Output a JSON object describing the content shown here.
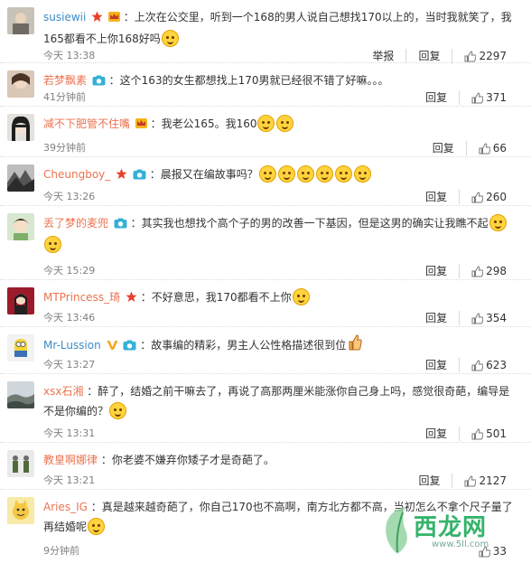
{
  "actions": {
    "report": "举报",
    "reply": "回复"
  },
  "comments": [
    {
      "user": "susiewii",
      "text": "：上次在公交里，听到一个168的男人说自己想找170以上的，当时我就笑了，我165都看不上你168好吗",
      "time": "今天 13:38",
      "likes": "2297",
      "has_report": true
    },
    {
      "user": "若梦飘素",
      "text": "：这个163的女生都想找上170男就已经很不错了好嘛。。。",
      "time": "41分钟前",
      "likes": "371"
    },
    {
      "user": "减不下肥管不住嘴",
      "text": "：我老公165。我160",
      "time": "39分钟前",
      "likes": "66"
    },
    {
      "user": "Cheungboy_",
      "text": "：晨报又在编故事吗？",
      "time": "今天 13:26",
      "likes": "260"
    },
    {
      "user": "丢了梦的麦兜",
      "text": "：其实我也想找个高个子的男的改善一下基因，但是这男的确实让我瞧不起",
      "time": "今天 15:29",
      "likes": "298"
    },
    {
      "user": "MTPrincess_琦",
      "text": "：不好意思，我170都看不上你",
      "time": "今天 13:46",
      "likes": "354"
    },
    {
      "user": "Mr-Lussion",
      "text": "：故事编的精彩，男主人公性格描述很到位",
      "time": "今天 13:27",
      "likes": "623"
    },
    {
      "user": "xsx石湘",
      "text": "：醉了，结婚之前干嘛去了，再说了高那两厘米能涨你自己身上吗，感觉很奇葩，编导是不是你编的？",
      "time": "今天 13:31",
      "likes": "501"
    },
    {
      "user": "教皇啊娜律",
      "text": "：你老婆不嫌弃你矮子才是奇葩了。",
      "time": "今天 13:21",
      "likes": "2127"
    },
    {
      "user": "Aries_IG",
      "text": "：真是越来越奇葩了，你自己170也不高啊，南方北方都不高，当初怎么不拿个尺子量了再结婚呢",
      "time": "9分钟前",
      "likes": "33"
    }
  ],
  "watermark": {
    "brand": "西龙网",
    "url": "www.5ll.com"
  },
  "colors": {
    "username_orange": "#eb7350",
    "username_blue": "#3c8bc5",
    "meta_gray": "#808080"
  }
}
